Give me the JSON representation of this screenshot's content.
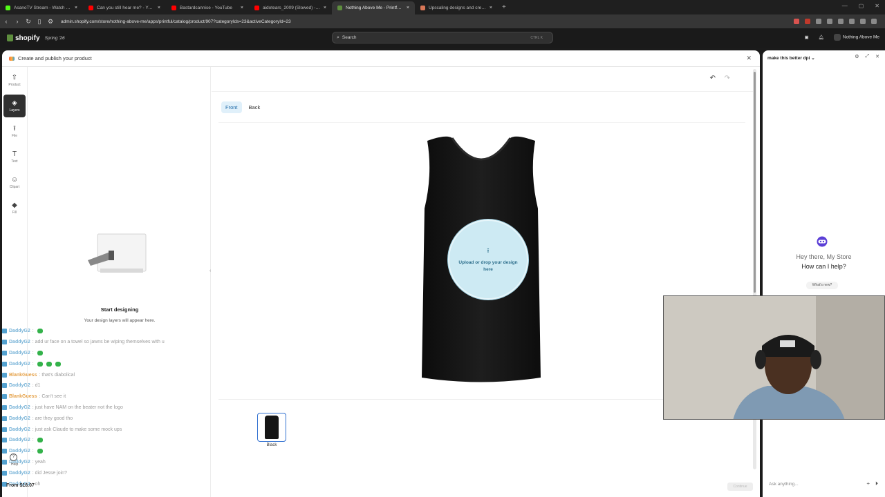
{
  "browser": {
    "tabs": [
      {
        "title": "AsanoTV Stream - Watch Live on Kick",
        "color": "#53fc18",
        "active": false
      },
      {
        "title": "Can you still hear me? - YouTube",
        "color": "#ff0000",
        "active": false
      },
      {
        "title": "Bastardcannise - YouTube",
        "color": "#ff0000",
        "active": false
      },
      {
        "title": "aidotears_2009 (Slowed) - YouTube",
        "color": "#ff0000",
        "active": false
      },
      {
        "title": "Nothing Above Me - Printful - Sh",
        "color": "#5e8e3e",
        "active": true
      },
      {
        "title": "Upscaling designs and creating Y2K",
        "color": "#d97757",
        "active": false
      }
    ],
    "url": "admin.shopify.com/store/nothing-above-me/apps/printful/catalog/product/907?categoryIds=23&activeCategoryId=23"
  },
  "shopify": {
    "logo": "shopify",
    "edition": "Spring '26",
    "search_placeholder": "Search",
    "search_shortcut": "CTRL K",
    "search_shortcut_x": "K",
    "store_name": "Nothing Above Me"
  },
  "app": {
    "title": "Create and publish your product",
    "rail": [
      {
        "label": "Product",
        "icon": "shirt-icon",
        "glyph": "⇧",
        "selected": false
      },
      {
        "label": "Layers",
        "icon": "layers-icon",
        "glyph": "◈",
        "selected": true
      },
      {
        "label": "File",
        "icon": "upload-icon",
        "glyph": "⭱",
        "selected": false
      },
      {
        "label": "Text",
        "icon": "text-icon",
        "glyph": "T",
        "selected": false
      },
      {
        "label": "Clipart",
        "icon": "smiley-icon",
        "glyph": "☺",
        "selected": false
      },
      {
        "label": "Fill",
        "icon": "paint-bucket-icon",
        "glyph": "◆",
        "selected": false
      }
    ],
    "layers_empty_title": "Start designing",
    "layers_empty_sub": "Your design layers will appear here.",
    "view_tabs": [
      "Front",
      "Back"
    ],
    "active_view": "Front",
    "upload_text": "Upload or drop your design here",
    "color_label": "Black",
    "continue_label": "Continue",
    "price": "From $18.07",
    "help_label": "Help"
  },
  "chat": [
    {
      "user": "DaddyG2",
      "msg": ":",
      "emotes": 1,
      "orange": false
    },
    {
      "user": "DaddyG2",
      "msg": ": add ur face on a towel so jawns be wiping themselves with u",
      "emotes": 0,
      "orange": false
    },
    {
      "user": "DaddyG2",
      "msg": ":",
      "emotes": 1,
      "orange": false
    },
    {
      "user": "DaddyG2",
      "msg": ":",
      "emotes": 3,
      "orange": false
    },
    {
      "user": "BlankGuess",
      "msg": ": that's diabolical",
      "emotes": 0,
      "orange": true
    },
    {
      "user": "DaddyG2",
      "msg": ": d1",
      "emotes": 0,
      "orange": false
    },
    {
      "user": "BlankGuess",
      "msg": ": Can't see it",
      "emotes": 0,
      "orange": true
    },
    {
      "user": "DaddyG2",
      "msg": ": just have NAM on the beater not the logo",
      "emotes": 0,
      "orange": false
    },
    {
      "user": "DaddyG2",
      "msg": ": are they good tho",
      "emotes": 0,
      "orange": false
    },
    {
      "user": "DaddyG2",
      "msg": ": just ask Claude to make some mock ups",
      "emotes": 0,
      "orange": false
    },
    {
      "user": "DaddyG2",
      "msg": ":",
      "emotes": 1,
      "orange": false
    },
    {
      "user": "DaddyG2",
      "msg": ":",
      "emotes": 1,
      "orange": false
    },
    {
      "user": "DaddyG2",
      "msg": ": yeah",
      "emotes": 0,
      "orange": false
    },
    {
      "user": "DaddyG2",
      "msg": ": did Jesse join?",
      "emotes": 0,
      "orange": false
    },
    {
      "user": "DaddyG2",
      "msg": ": oh",
      "emotes": 0,
      "orange": false
    }
  ],
  "sidekick": {
    "title": "make this better dpi",
    "greeting": "Hey there, My Store",
    "question": "How can I help?",
    "whats_new": "What's new?",
    "ask_placeholder": "Ask anything..."
  }
}
